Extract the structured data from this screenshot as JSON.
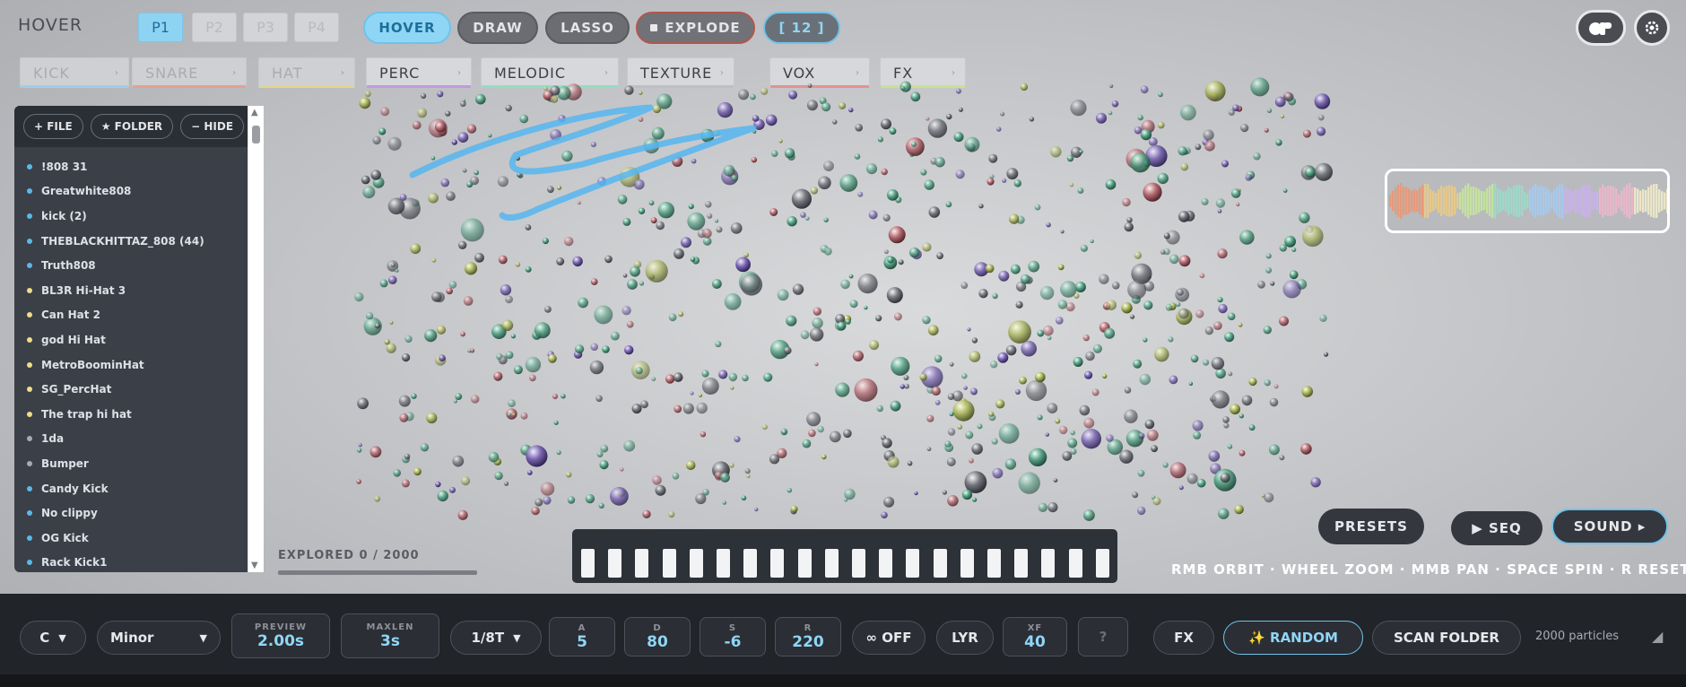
{
  "header": {
    "mode_title": "HOVER",
    "pages": [
      "P1",
      "P2",
      "P3",
      "P4"
    ],
    "active_page": "P1",
    "tools": {
      "hover": "HOVER",
      "draw": "DRAW",
      "lasso": "LASSO",
      "explode": "EXPLODE",
      "counter": "[ 12 ]"
    },
    "active_tool": "HOVER"
  },
  "categories": [
    {
      "label": "KICK",
      "color": "#9bd0ea"
    },
    {
      "label": "SNARE",
      "color": "#e7a08d"
    },
    {
      "label": "HAT",
      "color": "#e3d58b"
    },
    {
      "label": "PERC",
      "color": "#c09be0"
    },
    {
      "label": "MELODIC",
      "color": "#8fe0bf"
    },
    {
      "label": "TEXTURE",
      "color": "#bdbfc3"
    },
    {
      "label": "VOX",
      "color": "#e3938f"
    },
    {
      "label": "FX",
      "color": "#c7e28f"
    }
  ],
  "sidebar": {
    "buttons": {
      "file": "+ FILE",
      "folder": "★ FOLDER",
      "hide": "− HIDE"
    },
    "files": [
      {
        "name": "!808 31",
        "color": "#5ab8ea"
      },
      {
        "name": "Greatwhite808",
        "color": "#5ab8ea"
      },
      {
        "name": "kick (2)",
        "color": "#5ab8ea"
      },
      {
        "name": "THEBLACKHITTAZ_808 (44)",
        "color": "#5ab8ea"
      },
      {
        "name": "Truth808",
        "color": "#5ab8ea"
      },
      {
        "name": "BL3R Hi-Hat 3",
        "color": "#f0dc8a"
      },
      {
        "name": "Can Hat 2",
        "color": "#f0dc8a"
      },
      {
        "name": "god Hi Hat",
        "color": "#f0dc8a"
      },
      {
        "name": "MetroBoominHat",
        "color": "#f0dc8a"
      },
      {
        "name": "SG_PercHat",
        "color": "#f0dc8a"
      },
      {
        "name": "The trap hi hat",
        "color": "#f0dc8a"
      },
      {
        "name": "1da",
        "color": "#a8abb2"
      },
      {
        "name": "Bumper",
        "color": "#a8abb2"
      },
      {
        "name": "Candy Kick",
        "color": "#5ab8ea"
      },
      {
        "name": "No clippy",
        "color": "#5ab8ea"
      },
      {
        "name": "OG Kick",
        "color": "#5ab8ea"
      },
      {
        "name": "Rack Kick1",
        "color": "#5ab8ea"
      }
    ]
  },
  "explored": "EXPLORED 0 / 2000",
  "buttons": {
    "presets": "PRESETS",
    "seq": "▶ SEQ",
    "sound": "SOUND ▸"
  },
  "hint": "RMB ORBIT · WHEEL ZOOM · MMB PAN · SPACE SPIN · R RESET",
  "bottom": {
    "key": "C",
    "scale": "Minor",
    "preview": {
      "label": "PREVIEW",
      "value": "2.00s"
    },
    "maxlen": {
      "label": "MAXLEN",
      "value": "3s"
    },
    "division": "1/8T",
    "attack": {
      "label": "A",
      "value": "5"
    },
    "decay": {
      "label": "D",
      "value": "80"
    },
    "sustain": {
      "label": "S",
      "value": "-6"
    },
    "release": {
      "label": "R",
      "value": "220"
    },
    "loop": "∞ OFF",
    "layer": "LYR",
    "xfade": {
      "label": "XF",
      "value": "40"
    },
    "help": "?",
    "fx": "FX",
    "random": "✨ RANDOM",
    "scan": "SCAN FOLDER",
    "particle_count": "2000 particles"
  },
  "icons": {
    "logo": "brand-logo-icon",
    "settings": "gear-icon"
  }
}
